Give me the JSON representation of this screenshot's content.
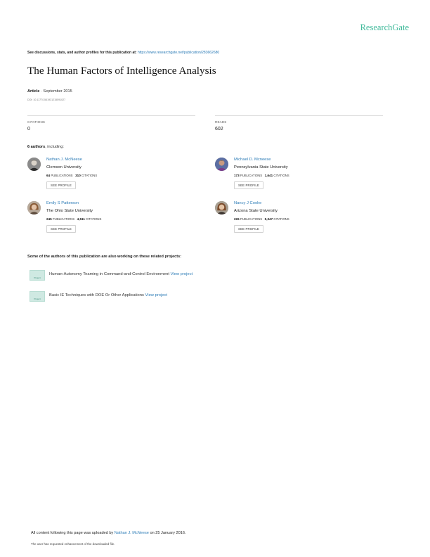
{
  "brand": {
    "logo_text": "ResearchGate",
    "accent": "#40ba9b",
    "link_color": "#2b7bb6"
  },
  "discussion": {
    "prefix": "See discussions, stats, and author profiles for this publication at:",
    "url_text": "https://www.researchgate.net/publication/283662680"
  },
  "publication": {
    "title": "The Human Factors of Intelligence Analysis",
    "type": "Article",
    "date": "· September 2015",
    "doi": "DOI: 10.1177/1541931215591027"
  },
  "stats": {
    "citations_label": "CITATIONS",
    "citations_value": "0",
    "reads_label": "READS",
    "reads_value": "602"
  },
  "authors_header": {
    "count": "6 authors",
    "suffix": ", including:"
  },
  "authors": [
    {
      "name": "Nathan J. McNeese",
      "institution": "Clemson University",
      "publications": "64",
      "publications_label": "PUBLICATIONS",
      "citations": "310",
      "citations_label": "CITATIONS",
      "button": "SEE PROFILE"
    },
    {
      "name": "Michael D. Mcneese",
      "institution": "Pennsylvania State University",
      "publications": "173",
      "publications_label": "PUBLICATIONS",
      "citations": "1,641",
      "citations_label": "CITATIONS",
      "button": "SEE PROFILE"
    },
    {
      "name": "Emily S Patterson",
      "institution": "The Ohio State University",
      "publications": "245",
      "publications_label": "PUBLICATIONS",
      "citations": "4,511",
      "citations_label": "CITATIONS",
      "button": "SEE PROFILE"
    },
    {
      "name": "Nancy J Cooke",
      "institution": "Arizona State University",
      "publications": "226",
      "publications_label": "PUBLICATIONS",
      "citations": "5,347",
      "citations_label": "CITATIONS",
      "button": "SEE PROFILE"
    }
  ],
  "projects_header": "Some of the authors of this publication are also working on these related projects:",
  "projects": [
    {
      "icon_label": "Project",
      "title": "Human-Autonomy Teaming in Command-and-Control Environment",
      "link": "View project"
    },
    {
      "icon_label": "Project",
      "title": "Basic IE Techniques with DOE Or Other Applications",
      "link": "View project"
    }
  ],
  "footer": {
    "prefix": "All content following this page was uploaded by",
    "uploader": "Nathan J. McNeese",
    "suffix": "on 25 January 2016.",
    "note": "The user has requested enhancement of the downloaded file."
  }
}
